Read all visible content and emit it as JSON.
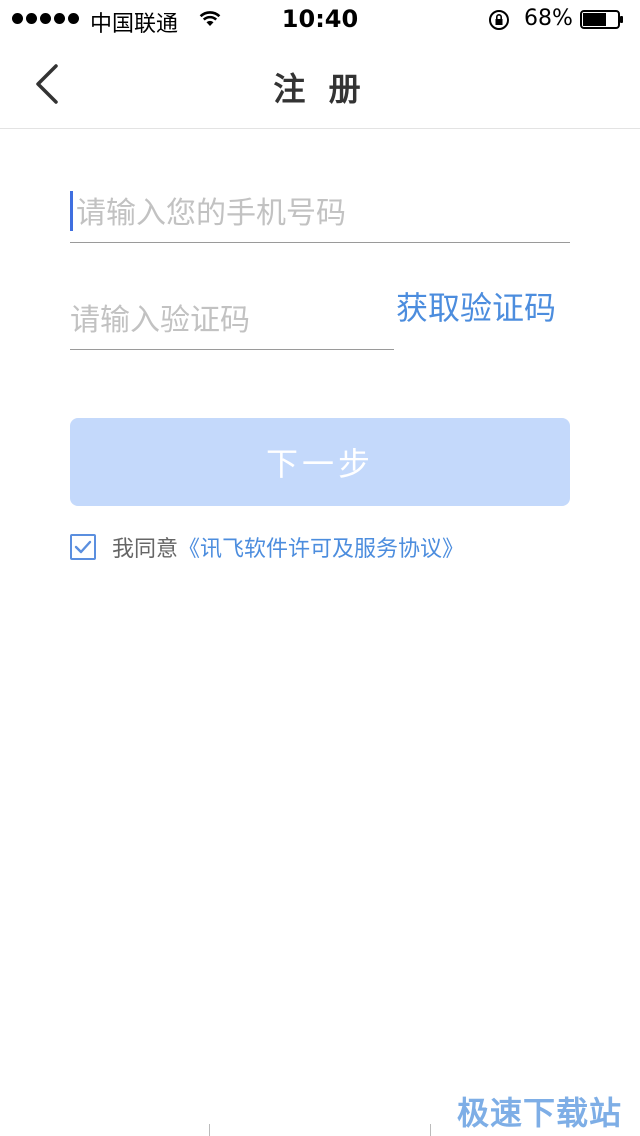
{
  "status_bar": {
    "carrier": "中国联通",
    "time": "10:40",
    "battery_percent": "68%",
    "battery_level": 0.68
  },
  "nav": {
    "back_icon": "chevron-left-icon",
    "title": "注 册"
  },
  "form": {
    "phone_placeholder": "请输入您的手机号码",
    "phone_value": "",
    "code_placeholder": "请输入验证码",
    "code_value": "",
    "get_code_label": "获取验证码",
    "next_label": "下一步",
    "agree_checked": true,
    "agree_prefix": "我同意",
    "agree_link": "《讯飞软件许可及服务协议》"
  },
  "watermark": "极速下载站",
  "colors": {
    "accent": "#4c8dde",
    "button_disabled": "#c4d9fb",
    "caret": "#3f6fe0"
  }
}
